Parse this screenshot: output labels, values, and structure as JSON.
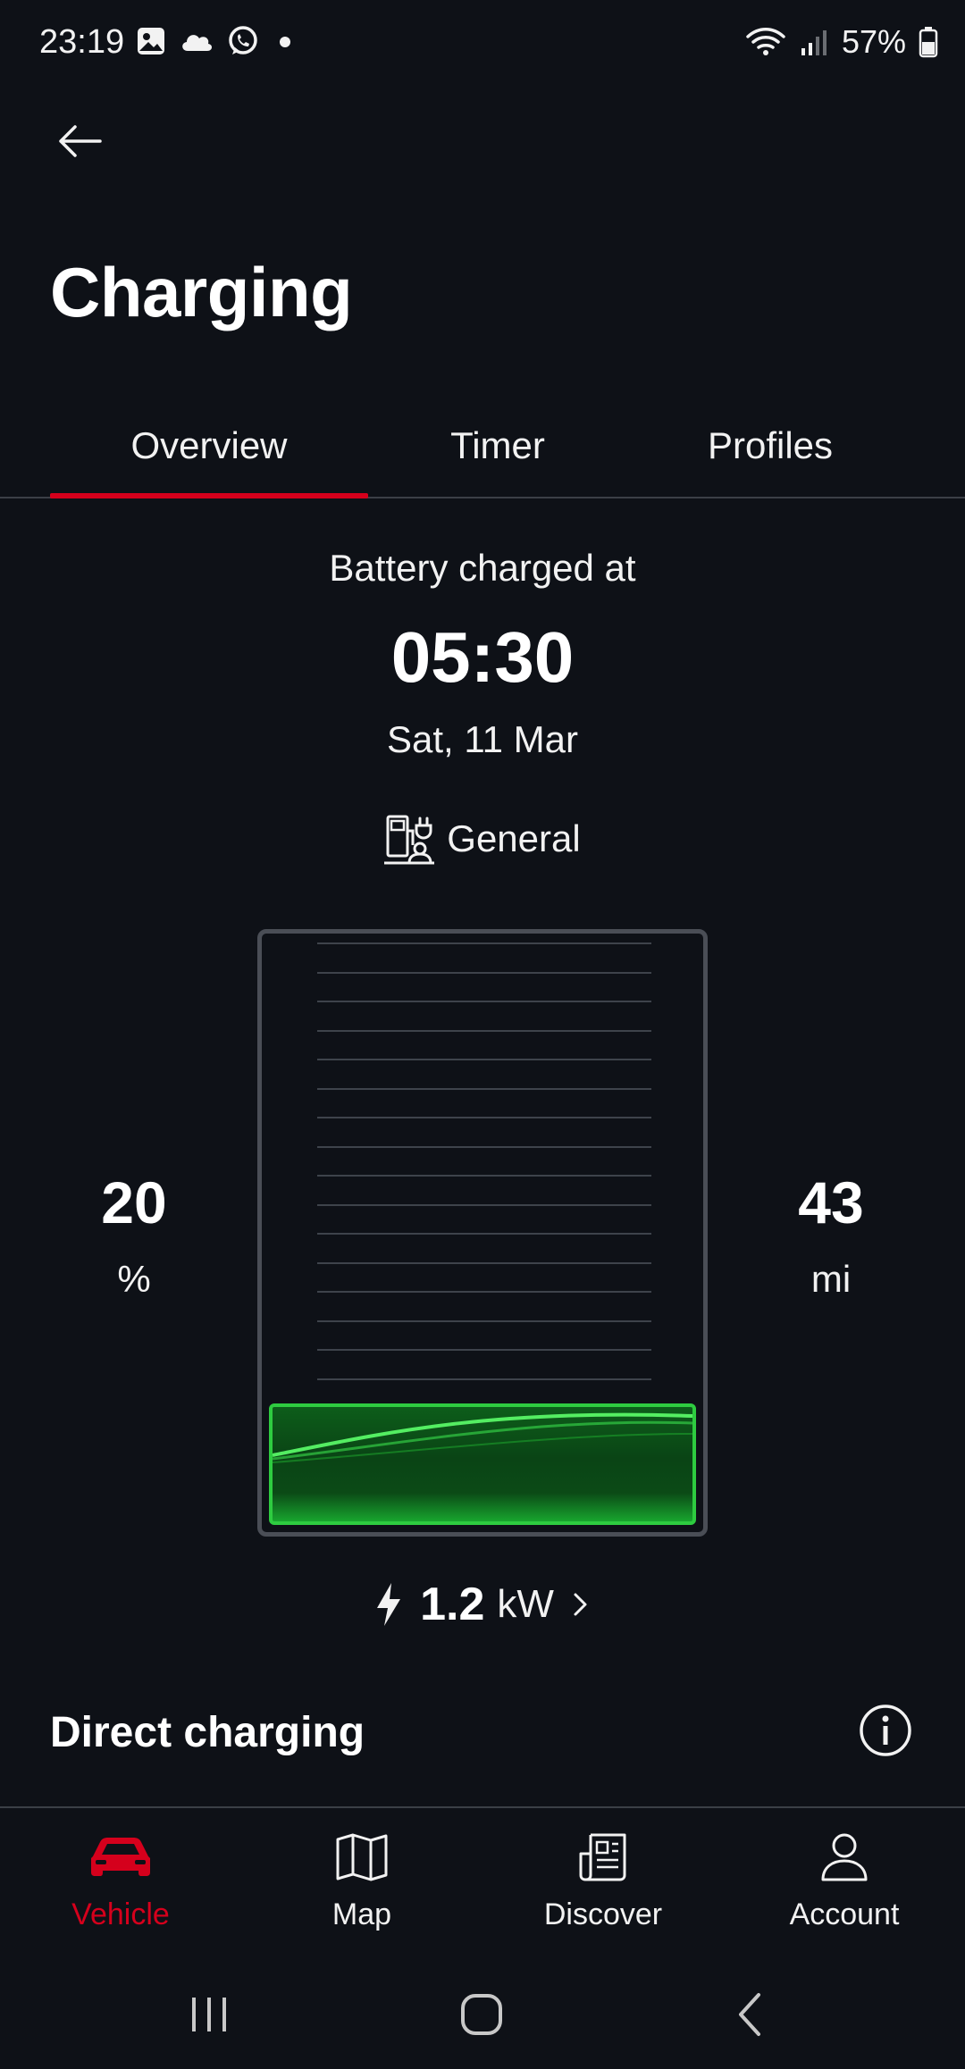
{
  "status_bar": {
    "time": "23:19",
    "battery_percent": "57%",
    "icons_left": [
      "gallery-icon",
      "cloud-icon",
      "whatsapp-icon",
      "dot-icon"
    ],
    "icons_right": [
      "wifi-icon",
      "signal-icon",
      "battery-icon"
    ]
  },
  "header": {
    "title": "Charging"
  },
  "tabs": [
    {
      "label": "Overview",
      "active": true
    },
    {
      "label": "Timer",
      "active": false
    },
    {
      "label": "Profiles",
      "active": false
    }
  ],
  "overview": {
    "battery_label": "Battery charged at",
    "charge_time": "05:30",
    "charge_date": "Sat, 11 Mar",
    "profile": "General",
    "state_of_charge": "20",
    "state_of_charge_unit": "%",
    "range": "43",
    "range_unit": "mi",
    "power_value": "1.2",
    "power_unit": "kW",
    "battery_fill_fraction": 0.2
  },
  "direct_charging": {
    "label": "Direct charging"
  },
  "bottom_nav": [
    {
      "label": "Vehicle",
      "icon": "car-icon",
      "active": true
    },
    {
      "label": "Map",
      "icon": "map-icon",
      "active": false
    },
    {
      "label": "Discover",
      "icon": "newspaper-icon",
      "active": false
    },
    {
      "label": "Account",
      "icon": "person-icon",
      "active": false
    }
  ],
  "colors": {
    "background": "#0e1117",
    "accent": "#d5001c",
    "battery_green": "#2ecc40"
  }
}
